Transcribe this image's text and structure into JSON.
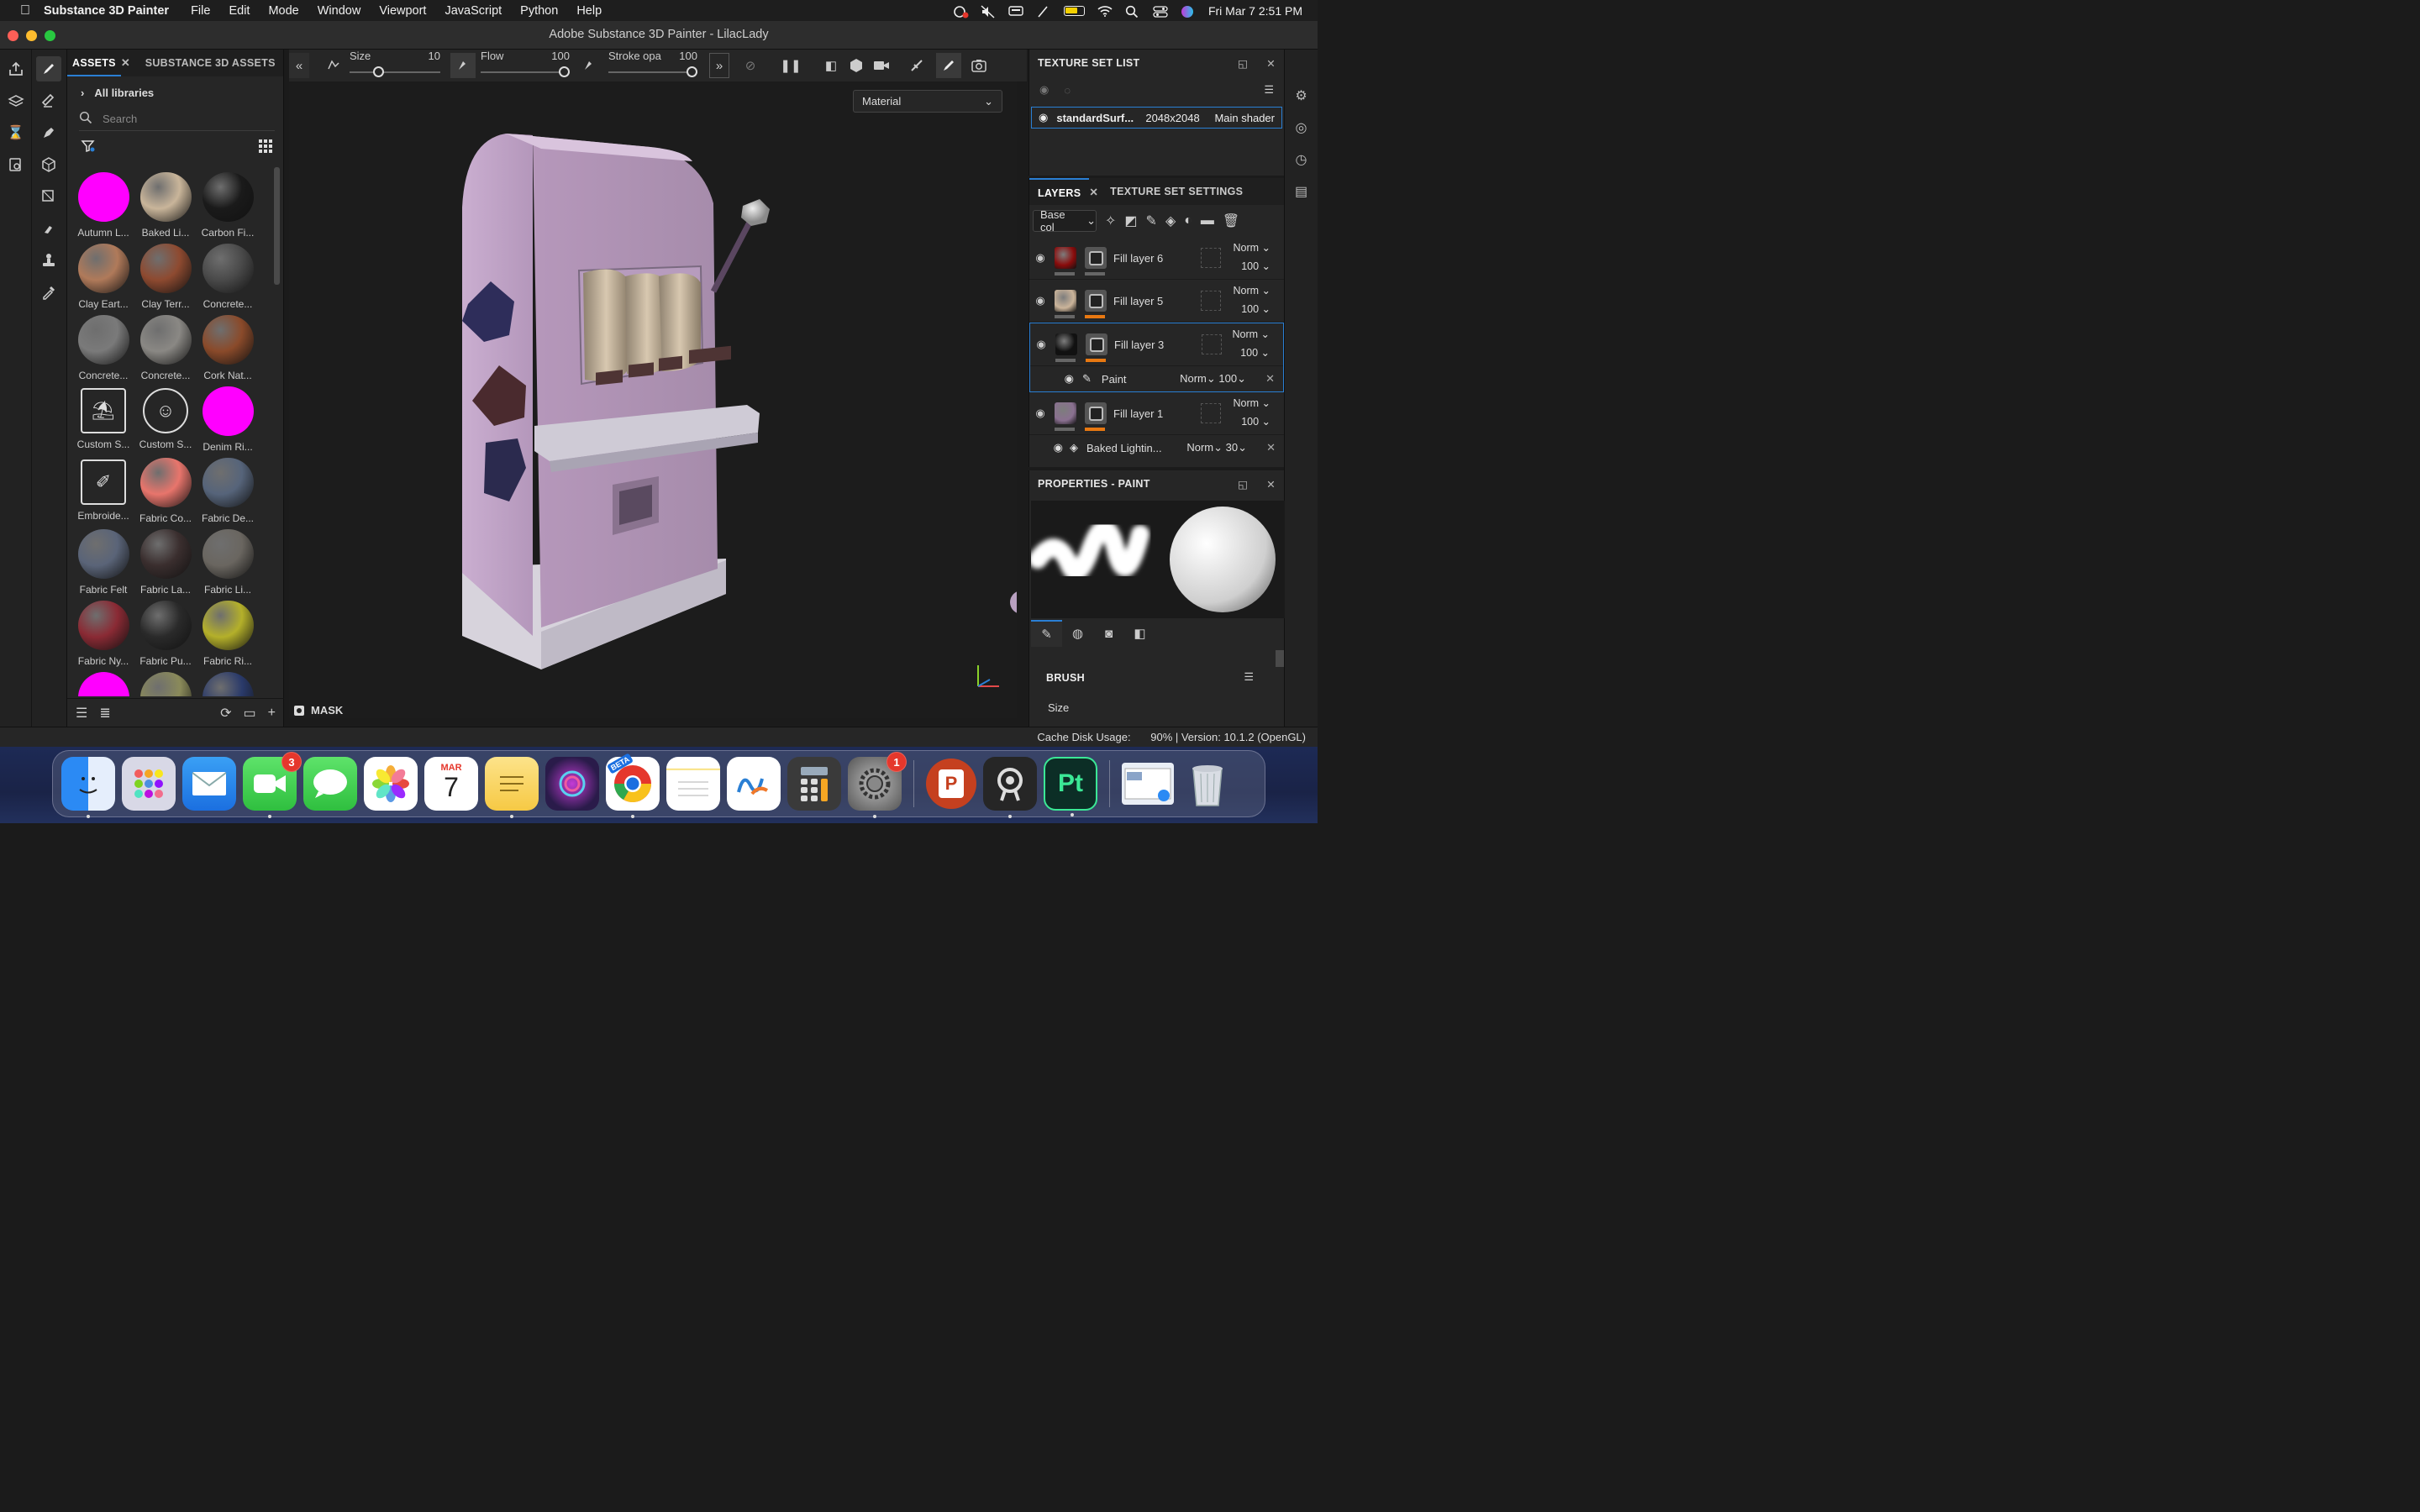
{
  "menubar": {
    "app_name": "Substance 3D Painter",
    "items": [
      "File",
      "Edit",
      "Mode",
      "Window",
      "Viewport",
      "JavaScript",
      "Python",
      "Help"
    ],
    "clock": "Fri Mar 7  2:51 PM"
  },
  "window": {
    "title": "Adobe Substance 3D Painter - LilacLady"
  },
  "assets": {
    "tab_assets": "ASSETS",
    "tab_substance": "SUBSTANCE 3D ASSETS",
    "all_libraries": "All libraries",
    "search_placeholder": "Search",
    "items": [
      {
        "label": "Autumn L...",
        "color": "#ff00ff"
      },
      {
        "label": "Baked Li...",
        "color": "#c9b59a"
      },
      {
        "label": "Carbon Fi...",
        "color": "#1a1a1a"
      },
      {
        "label": "Clay Eart...",
        "color": "#b07a5a"
      },
      {
        "label": "Clay Terr...",
        "color": "#8e4a30"
      },
      {
        "label": "Concrete...",
        "color": "#4a4a4a"
      },
      {
        "label": "Concrete...",
        "color": "#7a7a7a"
      },
      {
        "label": "Concrete...",
        "color": "#8a8884"
      },
      {
        "label": "Cork Nat...",
        "color": "#8a4a2a"
      },
      {
        "label": "Custom S...",
        "color": "icon"
      },
      {
        "label": "Custom S...",
        "color": "icon-face"
      },
      {
        "label": "Denim Ri...",
        "color": "#ff00ff"
      },
      {
        "label": "Embroide...",
        "color": "icon-embroid"
      },
      {
        "label": "Fabric Co...",
        "color": "#e8756c"
      },
      {
        "label": "Fabric De...",
        "color": "#56647a"
      },
      {
        "label": "Fabric Felt",
        "color": "#5a6478"
      },
      {
        "label": "Fabric La...",
        "color": "#3a2e2e"
      },
      {
        "label": "Fabric Li...",
        "color": "#6a6660"
      },
      {
        "label": "Fabric Ny...",
        "color": "#8a2a34"
      },
      {
        "label": "Fabric Pu...",
        "color": "#2a2a2a"
      },
      {
        "label": "Fabric Ri...",
        "color": "#b4b02a"
      }
    ]
  },
  "toolbar": {
    "size_label": "Size",
    "size_value": "10",
    "flow_label": "Flow",
    "flow_value": "100",
    "stroke_label": "Stroke opa",
    "stroke_value": "100"
  },
  "viewport": {
    "material_select": "Material",
    "mask_label": "MASK"
  },
  "texture_set_list": {
    "title": "TEXTURE SET LIST",
    "row_name": "standardSurf...",
    "row_size": "2048x2048",
    "row_shader": "Main shader"
  },
  "layers": {
    "tab_layers": "LAYERS",
    "tab_settings": "TEXTURE SET SETTINGS",
    "channel_select": "Base col",
    "items": [
      {
        "name": "Fill layer 6",
        "blend": "Norm",
        "opacity": "100",
        "thumb": "#8a0c0c",
        "bar": "#666"
      },
      {
        "name": "Fill layer 5",
        "blend": "Norm",
        "opacity": "100",
        "thumb": "#cbb49a",
        "bar": "#e87811"
      },
      {
        "name": "Fill layer 3",
        "blend": "Norm",
        "opacity": "100",
        "thumb": "#111",
        "bar": "#e87811"
      },
      {
        "name": "Fill layer 1",
        "blend": "Norm",
        "opacity": "100",
        "thumb": "#8a7090",
        "bar": "#e87811"
      }
    ],
    "paint_sublayer": {
      "name": "Paint",
      "blend": "Norm",
      "opacity": "100"
    },
    "baked_sublayer": {
      "name": "Baked Lightin...",
      "blend": "Norm",
      "opacity": "30"
    }
  },
  "properties": {
    "title": "PROPERTIES - PAINT",
    "brush_label": "BRUSH",
    "size_label": "Size"
  },
  "status": {
    "cache_label": "Cache Disk Usage:",
    "cache_value": "90% | Version: 10.1.2 (OpenGL)"
  },
  "dock": {
    "facetime_badge": "3",
    "settings_badge": "1",
    "calendar_month": "MAR",
    "calendar_day": "7",
    "chrome_badge": "BETA",
    "painter_label": "Pt",
    "powerpoint_label": "P"
  }
}
